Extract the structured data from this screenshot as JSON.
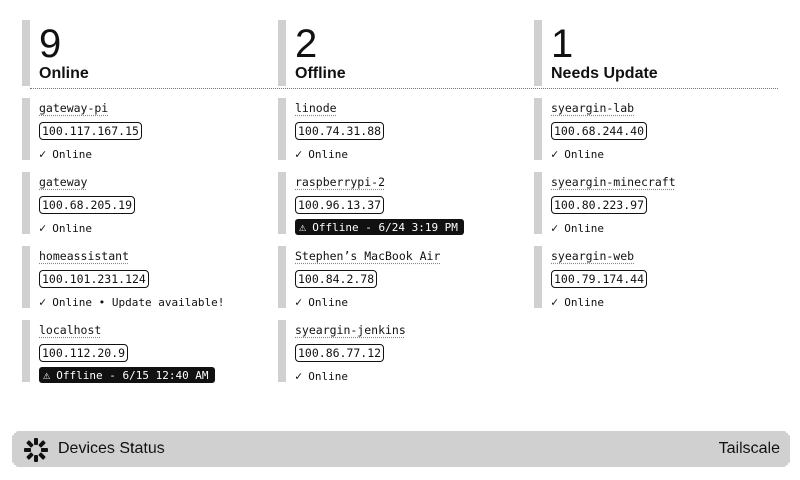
{
  "summary": [
    {
      "count": "9",
      "label": "Online"
    },
    {
      "count": "2",
      "label": "Offline"
    },
    {
      "count": "1",
      "label": "Needs Update"
    }
  ],
  "columns": [
    [
      {
        "name": "gateway-pi",
        "ip": "100.117.167.15",
        "status": "Online"
      },
      {
        "name": "gateway",
        "ip": "100.68.205.19",
        "status": "Online"
      },
      {
        "name": "homeassistant",
        "ip": "100.101.231.124",
        "status": "Online • Update available!"
      },
      {
        "name": "localhost",
        "ip": "100.112.20.9",
        "status": "Offline - 6/15 12:40 AM",
        "offline": true
      }
    ],
    [
      {
        "name": "linode",
        "ip": "100.74.31.88",
        "status": "Online"
      },
      {
        "name": "raspberrypi-2",
        "ip": "100.96.13.37",
        "status": "Offline - 6/24 3:19 PM",
        "offline": true
      },
      {
        "name": "Stephen’s MacBook Air",
        "ip": "100.84.2.78",
        "status": "Online"
      },
      {
        "name": "syeargin-jenkins",
        "ip": "100.86.77.12",
        "status": "Online"
      }
    ],
    [
      {
        "name": "syeargin-lab",
        "ip": "100.68.244.40",
        "status": "Online"
      },
      {
        "name": "syeargin-minecraft",
        "ip": "100.80.223.97",
        "status": "Online"
      },
      {
        "name": "syeargin-web",
        "ip": "100.79.174.44",
        "status": "Online"
      }
    ]
  ],
  "icons": {
    "online": "check-icon",
    "offline": "warning-icon",
    "logo": "tailscale-logo-icon"
  },
  "footer": {
    "title": "Devices Status",
    "brand": "Tailscale"
  }
}
